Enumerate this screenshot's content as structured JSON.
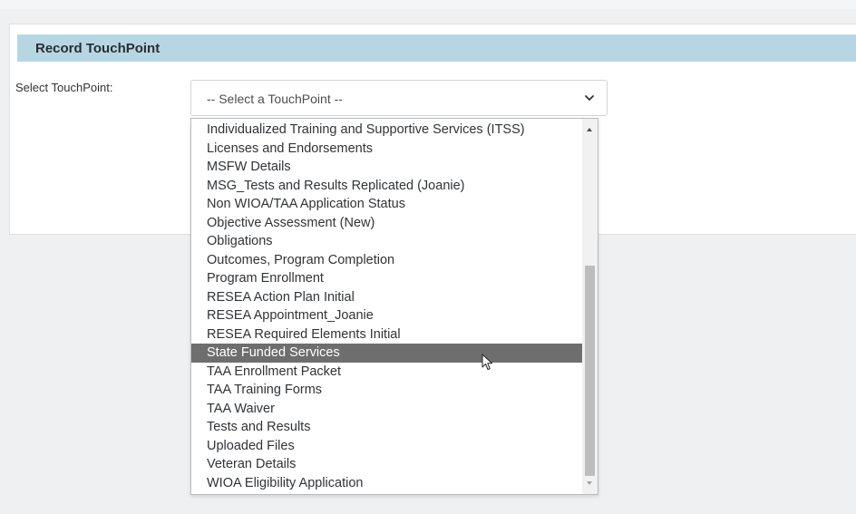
{
  "panel": {
    "title": "Record TouchPoint"
  },
  "form": {
    "select_label": "Select TouchPoint:",
    "select_value": "-- Select a TouchPoint --"
  },
  "dropdown": {
    "options": [
      "Individualized Training and Supportive Services (ITSS)",
      "Licenses and Endorsements",
      "MSFW Details",
      "MSG_Tests and Results Replicated (Joanie)",
      "Non WIOA/TAA Application Status",
      "Objective Assessment (New)",
      "Obligations",
      "Outcomes, Program Completion",
      "Program Enrollment",
      "RESEA Action Plan Initial",
      "RESEA Appointment_Joanie",
      "RESEA Required Elements Initial",
      "State Funded Services",
      "TAA Enrollment Packet",
      "TAA Training Forms",
      "TAA Waiver",
      "Tests and Results",
      "Uploaded Files",
      "Veteran Details",
      "WIOA Eligibility Application"
    ],
    "highlighted": "State Funded Services"
  },
  "icons": {
    "chevron": "chevron-down-icon",
    "cursor": "mouse-pointer-icon"
  },
  "colors": {
    "header_bg": "#b7d6e3",
    "highlight_bg": "#6e6e6e"
  }
}
